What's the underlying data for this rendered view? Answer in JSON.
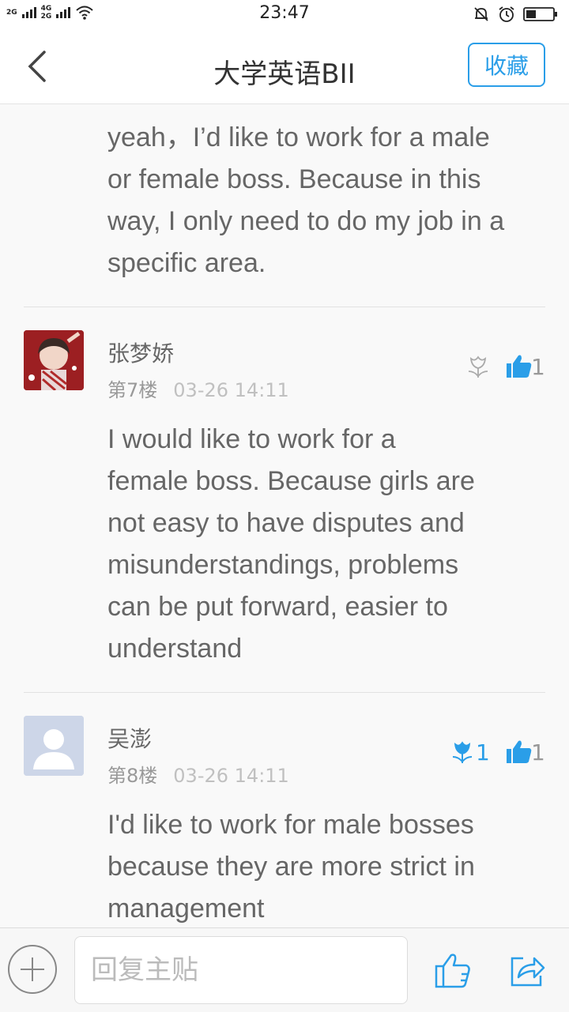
{
  "status_bar": {
    "network_1": "2G",
    "network_2": "4G",
    "network_3": "2G",
    "time": "23:47"
  },
  "header": {
    "title": "大学英语BII",
    "favorite_label": "收藏",
    "accent_color": "#2a9ee8"
  },
  "posts": [
    {
      "text": "yeah，I’d like to work for a male\nor female boss. Because in this\nway, I only need to do my job in a\nspecific area."
    },
    {
      "username": "张梦娇",
      "floor": "第7楼",
      "time": "03-26 14:11",
      "flower_count": "",
      "like_count": "1",
      "text": "I would  like to work for a\nfemale boss. Because girls are\nnot easy to have disputes and\nmisunderstandings, problems\ncan be put forward, easier to\nunderstand"
    },
    {
      "username": "吴澎",
      "floor": "第8楼",
      "time": "03-26 14:11",
      "flower_count": "1",
      "like_count": "1",
      "text": "I'd like to work for male bosses\nbecause they are more strict in\nmanagement"
    }
  ],
  "bottom_bar": {
    "reply_placeholder": "回复主贴"
  }
}
